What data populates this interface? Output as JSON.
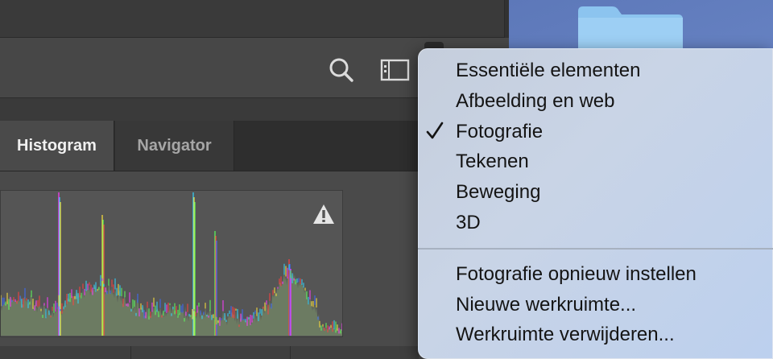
{
  "panel_tabs": [
    "Histogram",
    "Navigator"
  ],
  "menu": {
    "workspaces": [
      {
        "label": "Essentiële elementen",
        "checked": false
      },
      {
        "label": "Afbeelding en web",
        "checked": false
      },
      {
        "label": "Fotografie",
        "checked": true
      },
      {
        "label": "Tekenen",
        "checked": false
      },
      {
        "label": "Beweging",
        "checked": false
      },
      {
        "label": "3D",
        "checked": false
      }
    ],
    "actions": [
      "Fotografie opnieuw instellen",
      "Nieuwe werkruimte...",
      "Werkruimte verwijderen..."
    ]
  },
  "icons": {
    "search": "search-icon",
    "workspace": "workspace-switcher-icon",
    "warning": "warning-icon",
    "check": "checkmark-icon",
    "folder": "folder-icon"
  },
  "colors": {
    "histogram_gray": "#6c7b62",
    "histogram_background": "#555555",
    "warning": "#e6e6e6",
    "menu_background": "#c6d1e3",
    "desktop": "#6a86c6"
  }
}
